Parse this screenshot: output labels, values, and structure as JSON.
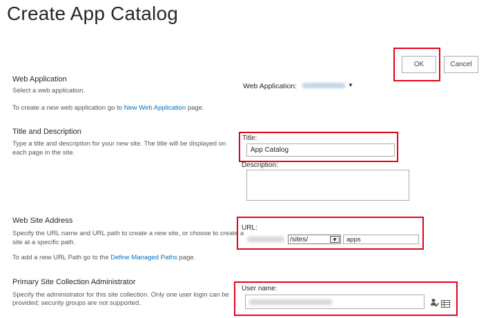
{
  "page": {
    "title": "Create App Catalog"
  },
  "buttons": {
    "ok": "OK",
    "cancel": "Cancel"
  },
  "web_application": {
    "section_title": "Web Application",
    "section_desc": "Select a web application.",
    "create_prefix": "To create a new web application go to ",
    "create_link": "New Web Application",
    "create_suffix": " page.",
    "field_label": "Web Application:",
    "selected_value": "",
    "dropdown_icon": "caret-down-icon"
  },
  "title_description": {
    "section_title": "Title and Description",
    "section_desc_1": "Type a title and description for your new site. The title will be displayed on",
    "section_desc_2": "each page in the site.",
    "title_label": "Title:",
    "title_value": "App Catalog",
    "description_label": "Description:",
    "description_value": ""
  },
  "web_site_address": {
    "section_title": "Web Site Address",
    "section_desc_1": "Specify the URL name and URL path to create a new site, or choose to create a",
    "section_desc_2": "site at a specific path.",
    "add_prefix": "To add a new URL Path go to the ",
    "add_link": "Define Managed Paths",
    "add_suffix": " page.",
    "url_label": "URL:",
    "path_selected": "/sites/",
    "site_name_value": "apps"
  },
  "admin": {
    "section_title": "Primary Site Collection Administrator",
    "section_desc_1": "Specify the administrator for this site collection. Only one user login can be",
    "section_desc_2": "provided; security groups are not supported.",
    "username_label": "User name:",
    "check_names_icon": "check-names-icon",
    "browse_icon": "address-book-icon"
  },
  "colors": {
    "highlight_box": "#e3001b",
    "link": "#0072c6"
  }
}
